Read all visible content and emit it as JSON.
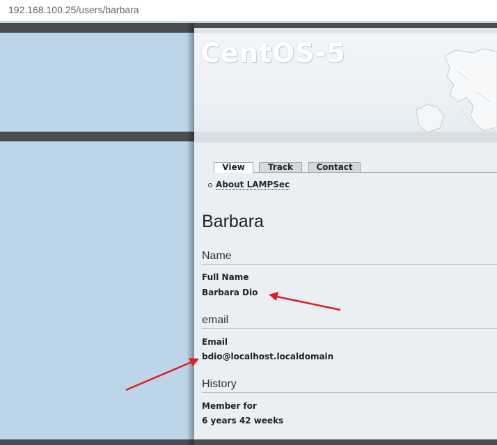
{
  "browser": {
    "url": "192.168.100.25/users/barbara"
  },
  "header": {
    "logo_text": "CentOS-5"
  },
  "tabs": [
    {
      "label": "View",
      "active": true
    },
    {
      "label": "Track",
      "active": false
    },
    {
      "label": "Contact",
      "active": false
    }
  ],
  "links": [
    {
      "label": "About LAMPSec"
    }
  ],
  "profile": {
    "title": "Barbara",
    "sections": [
      {
        "heading": "Name",
        "label": "Full Name",
        "value": "Barbara Dio"
      },
      {
        "heading": "email",
        "label": "Email",
        "value": "bdio@localhost.localdomain"
      },
      {
        "heading": "History",
        "label": "Member for",
        "value": "6 years 42 weeks"
      }
    ]
  },
  "annotations": [
    {
      "type": "arrow",
      "color": "#e02020",
      "points_to": "full-name-value"
    },
    {
      "type": "arrow",
      "color": "#e02020",
      "points_to": "email-value"
    }
  ]
}
